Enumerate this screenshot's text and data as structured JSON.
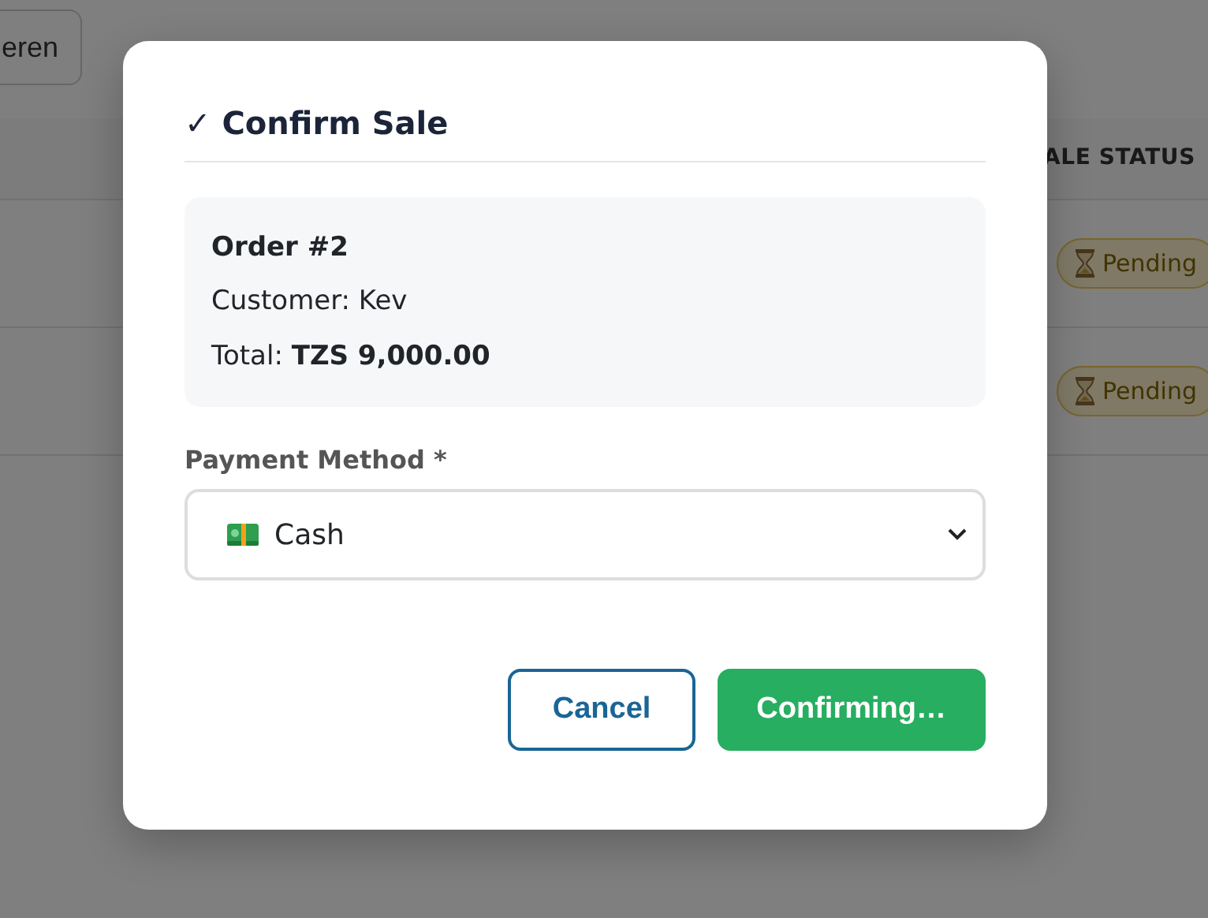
{
  "background": {
    "header_button": {
      "label": "eren"
    },
    "table": {
      "columns": [
        {
          "label": "ALE STATUS"
        }
      ],
      "rows": [
        {
          "status": "Pending"
        },
        {
          "status": "Pending"
        }
      ]
    }
  },
  "dialog": {
    "title": "✓ Confirm Sale",
    "order": {
      "title": "Order #2",
      "customer": "Customer: Kev",
      "total_label": "Total:",
      "total_value": "TZS 9,000.00"
    },
    "payment": {
      "label": "Payment Method *",
      "value": "Cash"
    },
    "buttons": [
      {
        "label": "Cancel",
        "kind": "outline"
      },
      {
        "label": "Confirming…",
        "kind": "primary"
      }
    ]
  }
}
